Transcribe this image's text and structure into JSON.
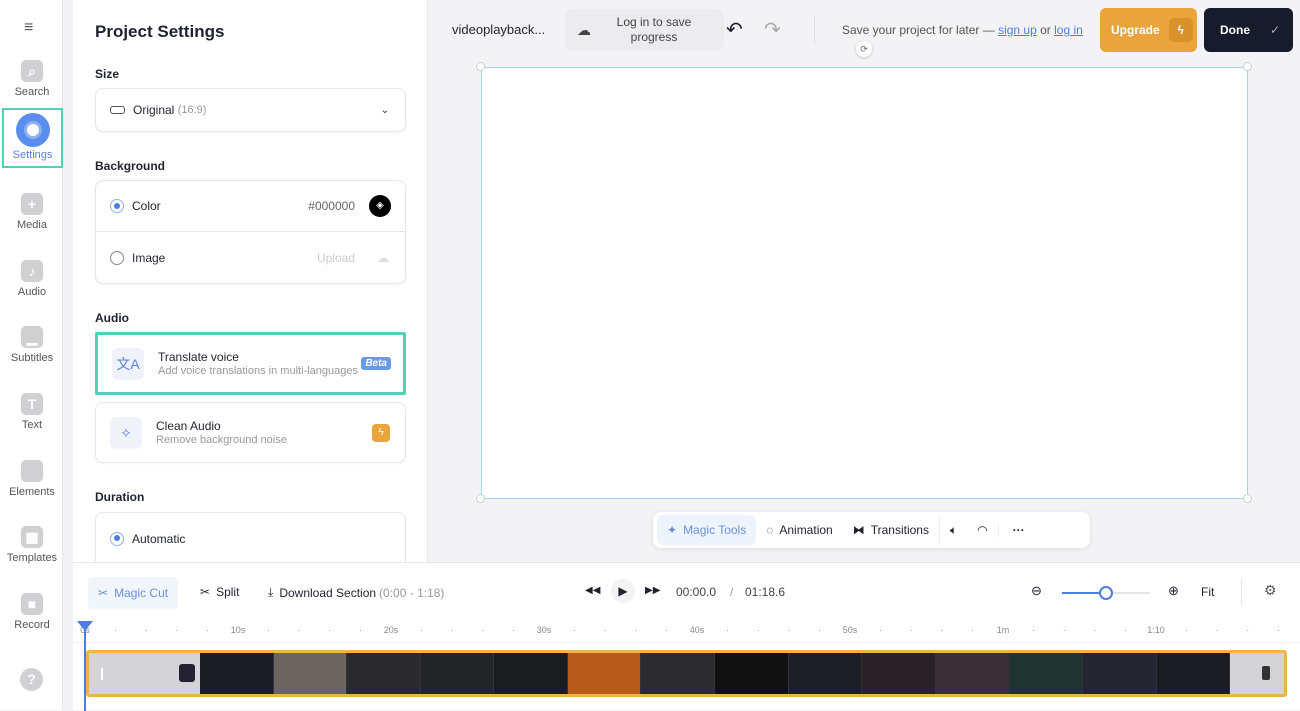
{
  "rail": {
    "items": [
      {
        "label": "Search",
        "icon": "search-icon",
        "glyph": "⌕"
      },
      {
        "label": "Settings",
        "icon": "settings-icon",
        "glyph": ""
      },
      {
        "label": "Media",
        "icon": "plus-icon",
        "glyph": "+"
      },
      {
        "label": "Audio",
        "icon": "music-note-icon",
        "glyph": "♪"
      },
      {
        "label": "Subtitles",
        "icon": "subtitles-icon",
        "glyph": "▁"
      },
      {
        "label": "Text",
        "icon": "text-icon",
        "glyph": "T"
      },
      {
        "label": "Elements",
        "icon": "elements-icon",
        "glyph": ""
      },
      {
        "label": "Templates",
        "icon": "templates-icon",
        "glyph": "▦"
      },
      {
        "label": "Record",
        "icon": "camera-icon",
        "glyph": "■"
      }
    ],
    "help_glyph": "?"
  },
  "panel": {
    "title": "Project Settings",
    "size_label": "Size",
    "size_value": "Original",
    "size_ratio": "(16:9)",
    "background_label": "Background",
    "color_label": "Color",
    "color_value": "#000000",
    "image_label": "Image",
    "upload_label": "Upload",
    "audio_label": "Audio",
    "translate_title": "Translate voice",
    "translate_desc": "Add voice translations in multi-languages",
    "beta_badge": "Beta",
    "clean_title": "Clean Audio",
    "clean_desc": "Remove background noise",
    "duration_label": "Duration",
    "automatic_label": "Automatic"
  },
  "topbar": {
    "project_name": "videoplayback...",
    "login_save": "Log in to save progress",
    "save_prompt": "Save your project for later —",
    "sign_up": "sign up",
    "or": "or",
    "log_in": "log in",
    "upgrade": "Upgrade",
    "done": "Done"
  },
  "toolbar": {
    "magic_tools": "Magic Tools",
    "animation": "Animation",
    "transitions": "Transitions"
  },
  "timeline": {
    "magic_cut": "Magic Cut",
    "split": "Split",
    "download_section": "Download Section",
    "download_range": "(0:00 - 1:18)",
    "current_time": "00:00.0",
    "separator": "/",
    "total_time": "01:18.6",
    "fit": "Fit",
    "zoom_level": 0.5,
    "ruler_labels": [
      "0s",
      "10s",
      "20s",
      "30s",
      "40s",
      "50s",
      "1m",
      "1:10"
    ]
  },
  "colors": {
    "accent": "#4a7fe0",
    "highlight": "#4fd1b5",
    "upgrade": "#e9a53b",
    "done": "#171b2b",
    "track_border": "#f0b34a"
  }
}
